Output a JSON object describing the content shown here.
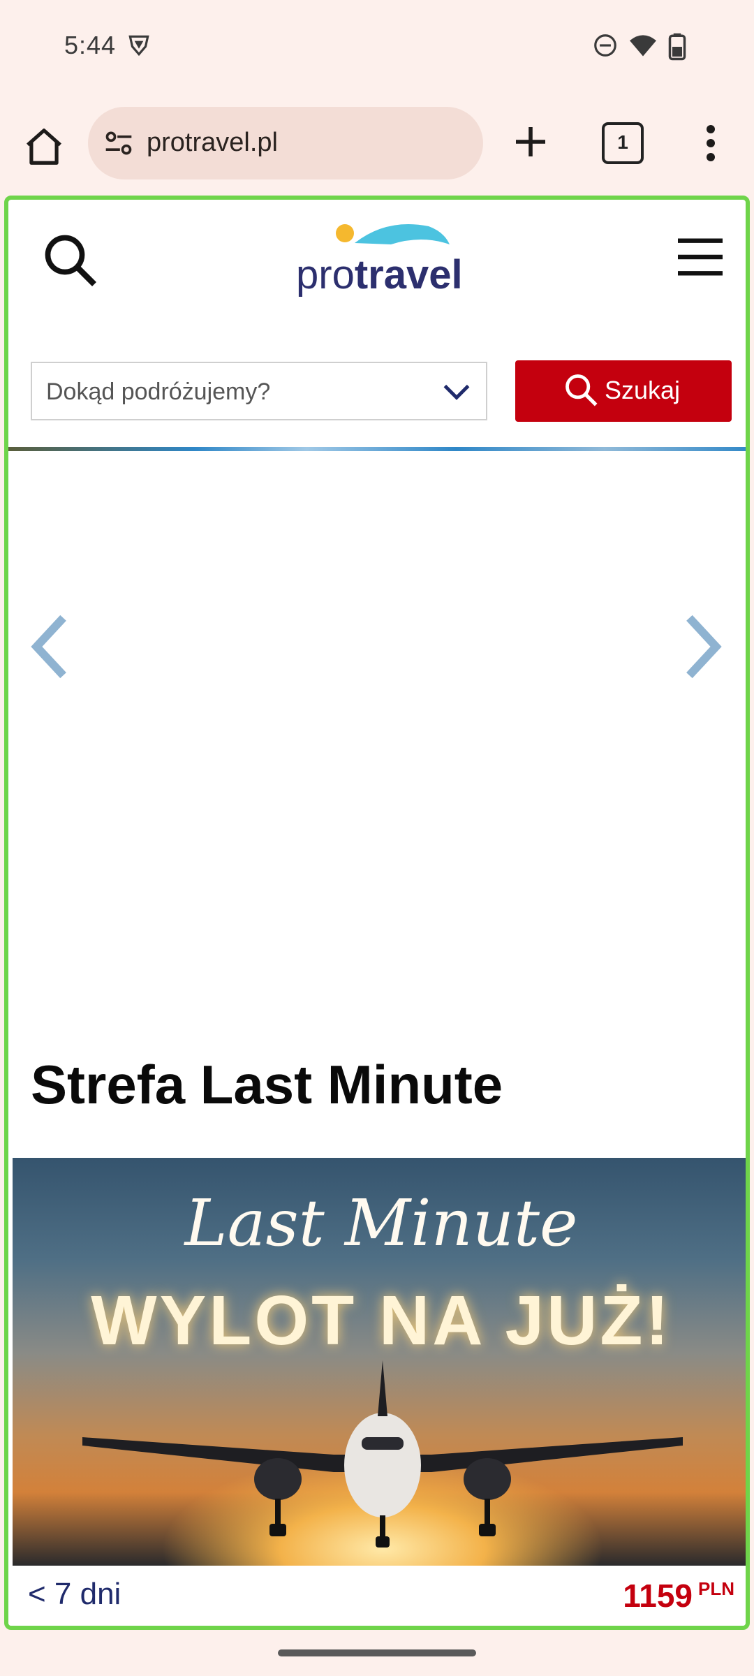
{
  "status_bar": {
    "time": "5:44",
    "icons": [
      "brave-shield-icon",
      "do-not-disturb-icon",
      "wifi-icon",
      "battery-icon"
    ]
  },
  "browser": {
    "url": "protravel.pl",
    "tab_count": "1",
    "icons": [
      "home-icon",
      "site-settings-icon",
      "plus-icon",
      "tabs-icon",
      "more-vert-icon"
    ]
  },
  "site": {
    "logo": {
      "pre": "pro",
      "bold": "travel"
    },
    "destination_placeholder": "Dokąd podróżujemy?",
    "search_button_label": "Szukaj",
    "section_title": "Strefa Last Minute",
    "banner": {
      "script_text": "Last Minute",
      "headline": "WYLOT NA JUŻ!"
    },
    "offer": {
      "duration": "< 7 dni",
      "price": "1159",
      "currency": "PLN"
    }
  },
  "colors": {
    "brand_red": "#c4000e",
    "brand_navy": "#2c2f6e",
    "logo_wave": "#4cc3e0",
    "logo_sun": "#f5b82e",
    "focus_border": "#6fd44a",
    "browser_bg": "#fdf0ec"
  }
}
